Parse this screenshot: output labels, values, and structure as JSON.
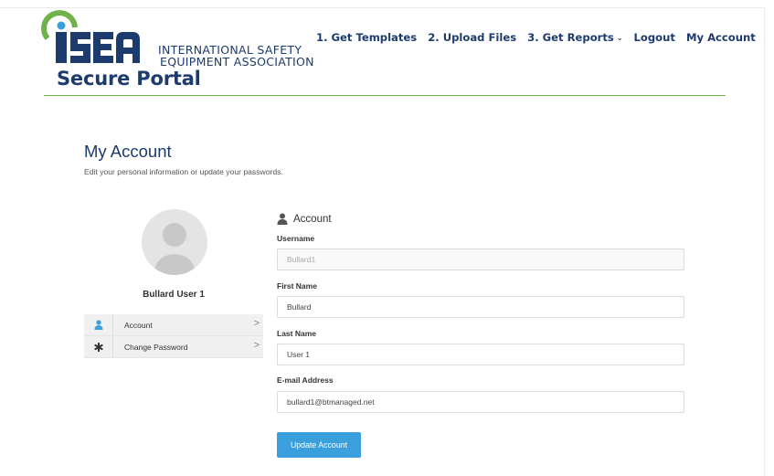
{
  "brand": {
    "logo_text": "ISEA",
    "org_line1": "INTERNATIONAL SAFETY",
    "org_line2": "EQUIPMENT ASSOCIATION",
    "portal_title": "Secure Portal",
    "colors": {
      "navy": "#1d3b6c",
      "green": "#6fb24a",
      "blue": "#3a9fdc"
    }
  },
  "nav": {
    "items": [
      {
        "label": "1. Get Templates"
      },
      {
        "label": "2. Upload Files"
      },
      {
        "label": "3. Get Reports",
        "has_dropdown": true
      },
      {
        "label": "Logout"
      },
      {
        "label": "My Account"
      }
    ]
  },
  "page": {
    "title": "My Account",
    "subtitle": "Edit your personal information or update your passwords."
  },
  "profile": {
    "name": "Bullard User 1",
    "menu": [
      {
        "label": "Account",
        "icon": "user-icon",
        "chevron": ">"
      },
      {
        "label": "Change Password",
        "icon": "asterisk-icon",
        "chevron": ">"
      }
    ]
  },
  "form": {
    "heading": "Account",
    "fields": {
      "username": {
        "label": "Username",
        "value": "Bullard1"
      },
      "first_name": {
        "label": "First Name",
        "value": "Bullard"
      },
      "last_name": {
        "label": "Last Name",
        "value": "User 1"
      },
      "email": {
        "label": "E-mail Address",
        "value": "bullard1@btmanaged.net"
      }
    },
    "submit_label": "Update Account"
  }
}
